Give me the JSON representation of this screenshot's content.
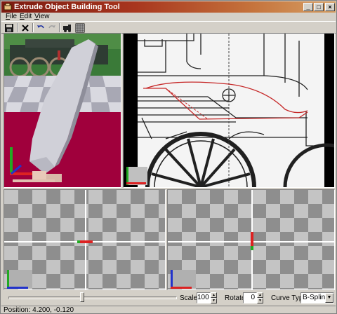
{
  "window": {
    "title": "Extrude Object Building Tool"
  },
  "title_buttons": {
    "minimize": "_",
    "maximize": "□",
    "close": "×"
  },
  "menu": {
    "items": [
      "File",
      "Edit",
      "View"
    ]
  },
  "toolbar": {
    "buttons": [
      "save-icon",
      "delete-icon",
      "undo-icon",
      "redo-icon",
      "train-icon",
      "grid-icon"
    ]
  },
  "controls": {
    "scale_label": "Scale",
    "scale_value": "100",
    "rotate_label": "Rotate",
    "rotate_value": "0",
    "curve_type_label": "Curve Type",
    "curve_type_value": "B-Spline"
  },
  "status": {
    "position": "Position: 4.200, -0.120"
  },
  "colors": {
    "curve": "#c62828",
    "axis_x": "#dd2222",
    "axis_y": "#22aa22",
    "axis_z": "#2233cc",
    "floor": "#a0003c"
  }
}
